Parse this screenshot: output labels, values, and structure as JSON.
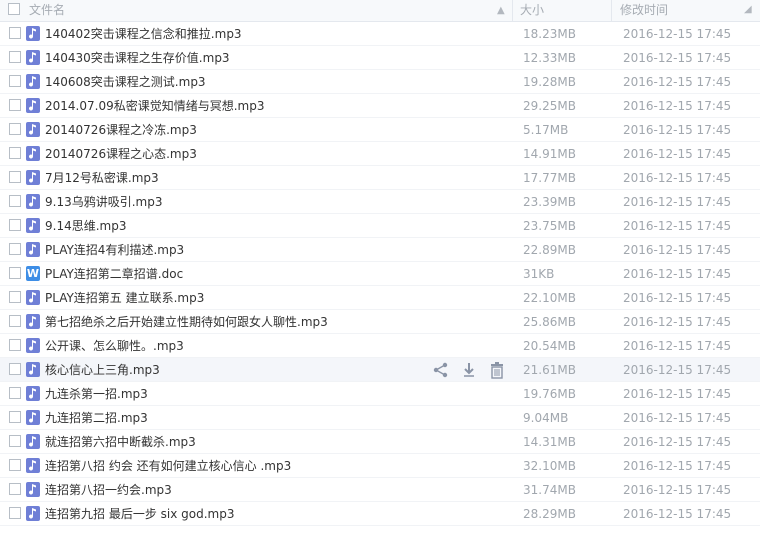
{
  "header": {
    "name_label": "文件名",
    "size_label": "大小",
    "date_label": "修改时间",
    "sort_indicator": "▲"
  },
  "colors": {
    "mp3_icon": "#6f7fd6",
    "doc_icon": "#3e8ee6",
    "hover_row": "#f4f6fa"
  },
  "row_actions": {
    "icons": [
      "share-icon",
      "download-icon",
      "delete-icon"
    ]
  },
  "files": [
    {
      "name": "140402突击课程之信念和推拉.mp3",
      "size": "18.23MB",
      "date": "2016-12-15 17:45",
      "type": "mp3",
      "icon_char": ""
    },
    {
      "name": "140430突击课程之生存价值.mp3",
      "size": "12.33MB",
      "date": "2016-12-15 17:45",
      "type": "mp3",
      "icon_char": ""
    },
    {
      "name": "140608突击课程之测试.mp3",
      "size": "19.28MB",
      "date": "2016-12-15 17:45",
      "type": "mp3",
      "icon_char": ""
    },
    {
      "name": "2014.07.09私密课觉知情绪与冥想.mp3",
      "size": "29.25MB",
      "date": "2016-12-15 17:45",
      "type": "mp3",
      "icon_char": ""
    },
    {
      "name": "20140726课程之冷冻.mp3",
      "size": "5.17MB",
      "date": "2016-12-15 17:45",
      "type": "mp3",
      "icon_char": ""
    },
    {
      "name": "20140726课程之心态.mp3",
      "size": "14.91MB",
      "date": "2016-12-15 17:45",
      "type": "mp3",
      "icon_char": ""
    },
    {
      "name": "7月12号私密课.mp3",
      "size": "17.77MB",
      "date": "2016-12-15 17:45",
      "type": "mp3",
      "icon_char": ""
    },
    {
      "name": "9.13乌鸦讲吸引.mp3",
      "size": "23.39MB",
      "date": "2016-12-15 17:45",
      "type": "mp3",
      "icon_char": ""
    },
    {
      "name": "9.14思维.mp3",
      "size": "23.75MB",
      "date": "2016-12-15 17:45",
      "type": "mp3",
      "icon_char": ""
    },
    {
      "name": "PLAY连招4有利描述.mp3",
      "size": "22.89MB",
      "date": "2016-12-15 17:45",
      "type": "mp3",
      "icon_char": ""
    },
    {
      "name": "PLAY连招第二章招谱.doc",
      "size": "31KB",
      "date": "2016-12-15 17:45",
      "type": "doc",
      "icon_char": "W"
    },
    {
      "name": "PLAY连招第五 建立联系.mp3",
      "size": "22.10MB",
      "date": "2016-12-15 17:45",
      "type": "mp3",
      "icon_char": ""
    },
    {
      "name": "第七招绝杀之后开始建立性期待如何跟女人聊性.mp3",
      "size": "25.86MB",
      "date": "2016-12-15 17:45",
      "type": "mp3",
      "icon_char": ""
    },
    {
      "name": "公开课、怎么聊性。.mp3",
      "size": "20.54MB",
      "date": "2016-12-15 17:45",
      "type": "mp3",
      "icon_char": ""
    },
    {
      "name": "核心信心上三角.mp3",
      "size": "21.61MB",
      "date": "2016-12-15 17:45",
      "type": "mp3",
      "icon_char": ""
    },
    {
      "name": "九连杀第一招.mp3",
      "size": "19.76MB",
      "date": "2016-12-15 17:45",
      "type": "mp3",
      "icon_char": ""
    },
    {
      "name": "九连招第二招.mp3",
      "size": "9.04MB",
      "date": "2016-12-15 17:45",
      "type": "mp3",
      "icon_char": ""
    },
    {
      "name": "就连招第六招中断截杀.mp3",
      "size": "14.31MB",
      "date": "2016-12-15 17:45",
      "type": "mp3",
      "icon_char": ""
    },
    {
      "name": "连招第八招 约会   还有如何建立核心信心 .mp3",
      "size": "32.10MB",
      "date": "2016-12-15 17:45",
      "type": "mp3",
      "icon_char": ""
    },
    {
      "name": "连招第八招一约会.mp3",
      "size": "31.74MB",
      "date": "2016-12-15 17:45",
      "type": "mp3",
      "icon_char": ""
    },
    {
      "name": "连招第九招 最后一步 six god.mp3",
      "size": "28.29MB",
      "date": "2016-12-15 17:45",
      "type": "mp3",
      "icon_char": ""
    }
  ]
}
